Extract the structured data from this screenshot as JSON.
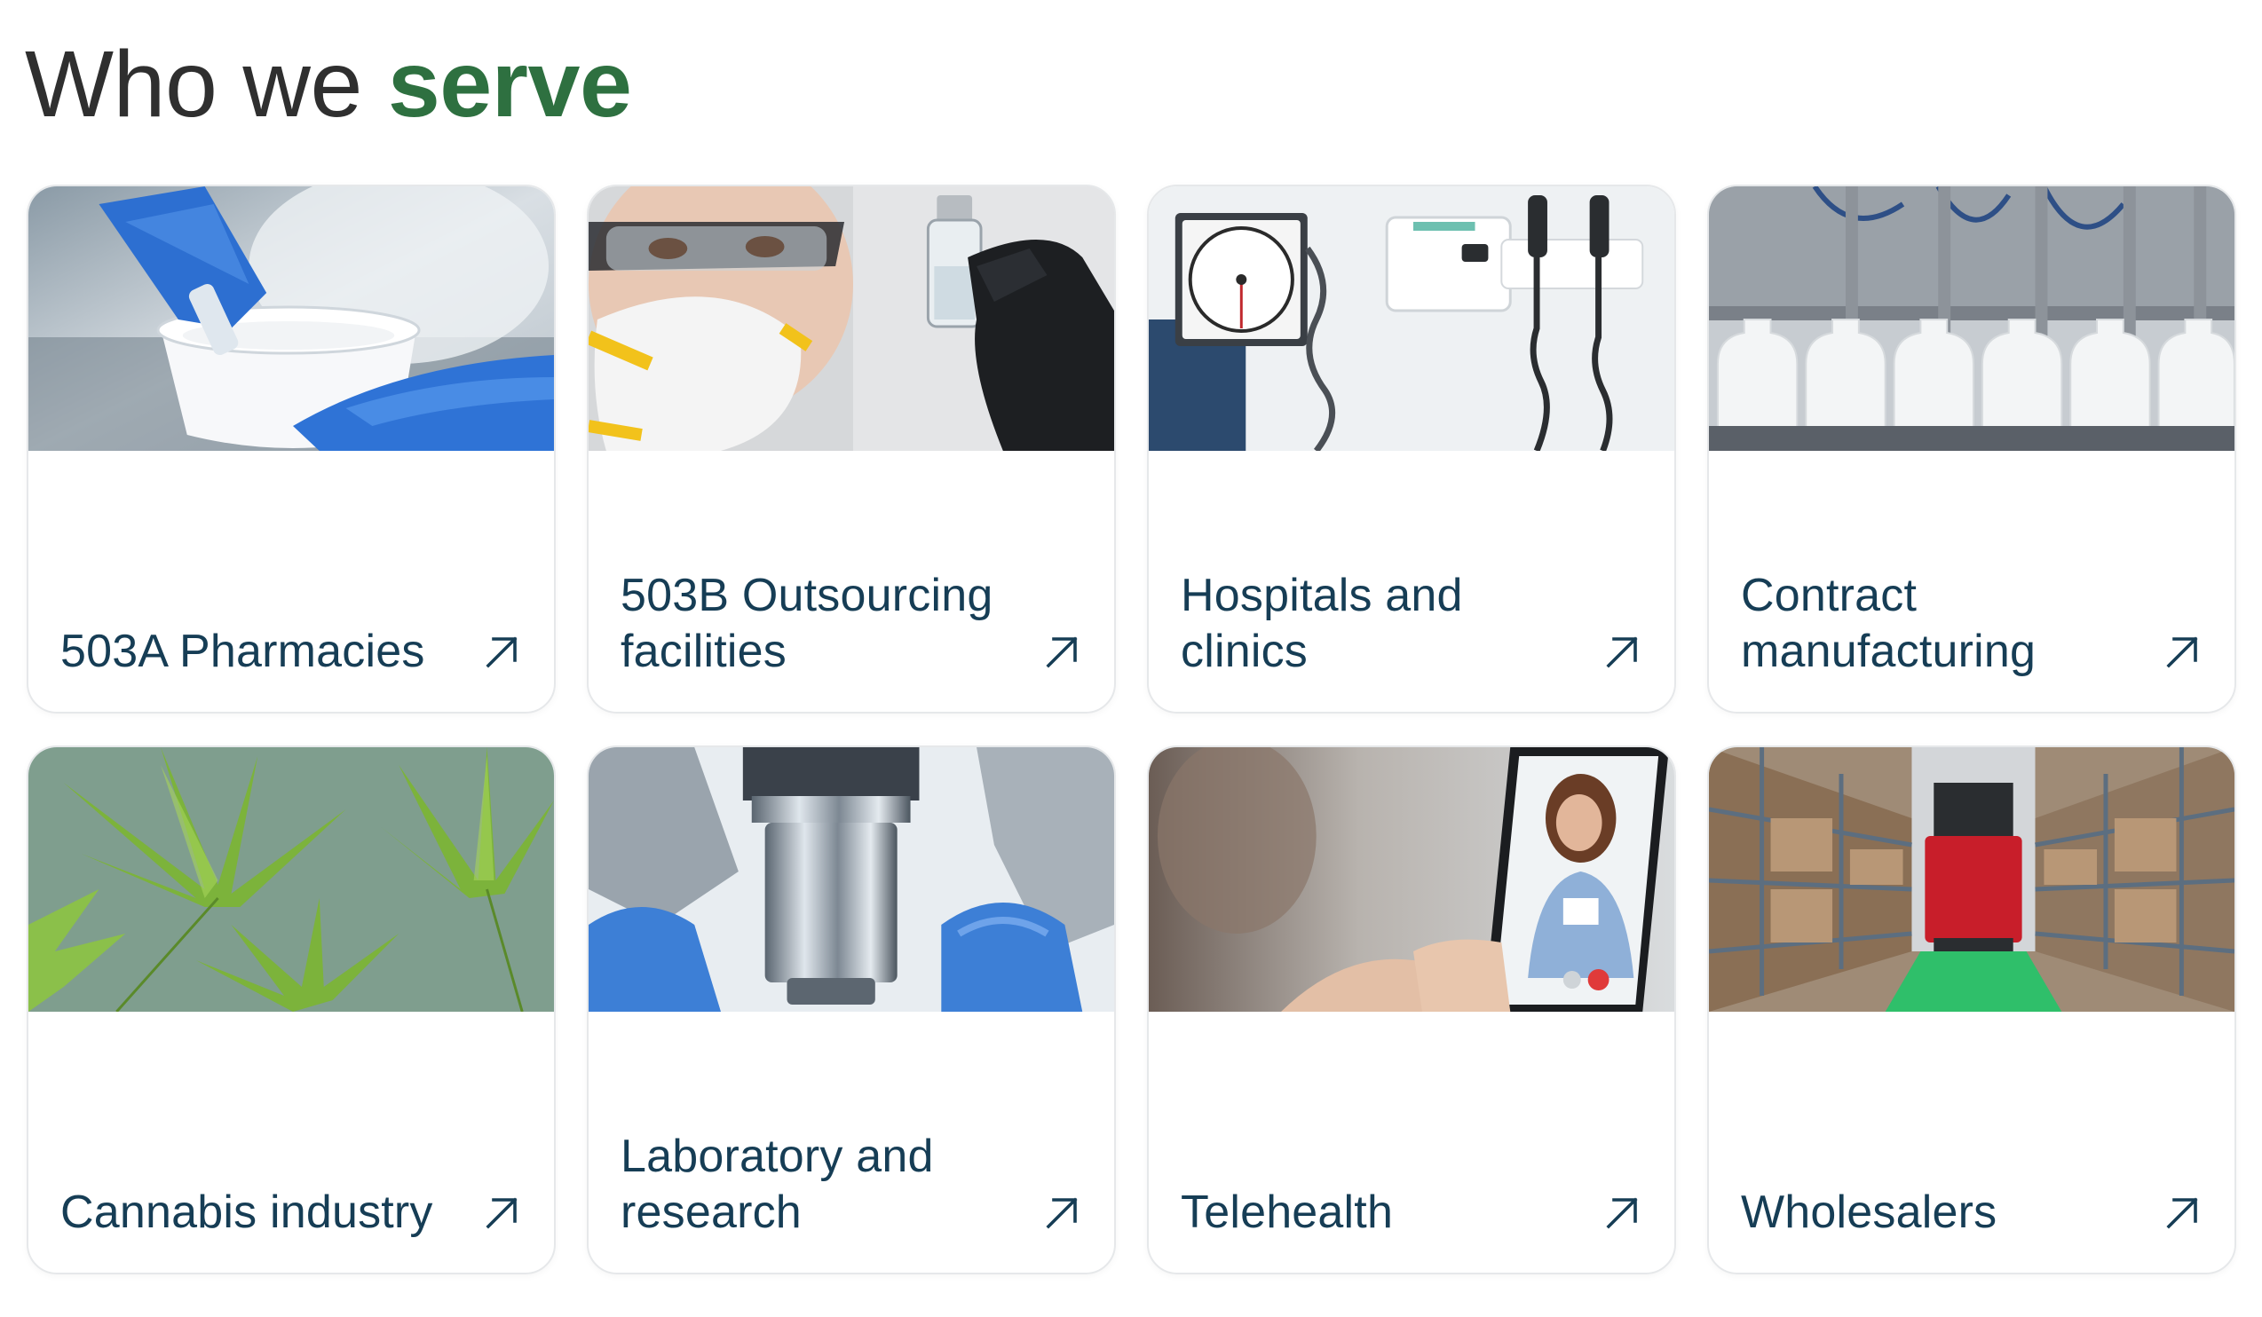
{
  "header": {
    "title_plain": "Who we ",
    "title_accent": "serve"
  },
  "colors": {
    "accent": "#2e7040",
    "card_text": "#163d55",
    "heading_text": "#2f2f2f",
    "card_border": "#e6e8ea"
  },
  "cards": [
    {
      "label": "503A Pharmacies",
      "image": "pharmacy-compounding-photo",
      "icon": "arrow-up-right-icon"
    },
    {
      "label": "503B Outsourcing facilities",
      "image": "lab-worker-vial-photo",
      "icon": "arrow-up-right-icon"
    },
    {
      "label": "Hospitals and clinics",
      "image": "wall-medical-equipment-photo",
      "icon": "arrow-up-right-icon"
    },
    {
      "label": "Contract manufacturing",
      "image": "bottle-filling-line-photo",
      "icon": "arrow-up-right-icon"
    },
    {
      "label": "Cannabis industry",
      "image": "cannabis-leaves-photo",
      "icon": "arrow-up-right-icon"
    },
    {
      "label": "Laboratory and research",
      "image": "microscope-photo",
      "icon": "arrow-up-right-icon"
    },
    {
      "label": "Telehealth",
      "image": "video-call-doctor-photo",
      "icon": "arrow-up-right-icon"
    },
    {
      "label": "Wholesalers",
      "image": "warehouse-aisle-photo",
      "icon": "arrow-up-right-icon"
    }
  ]
}
